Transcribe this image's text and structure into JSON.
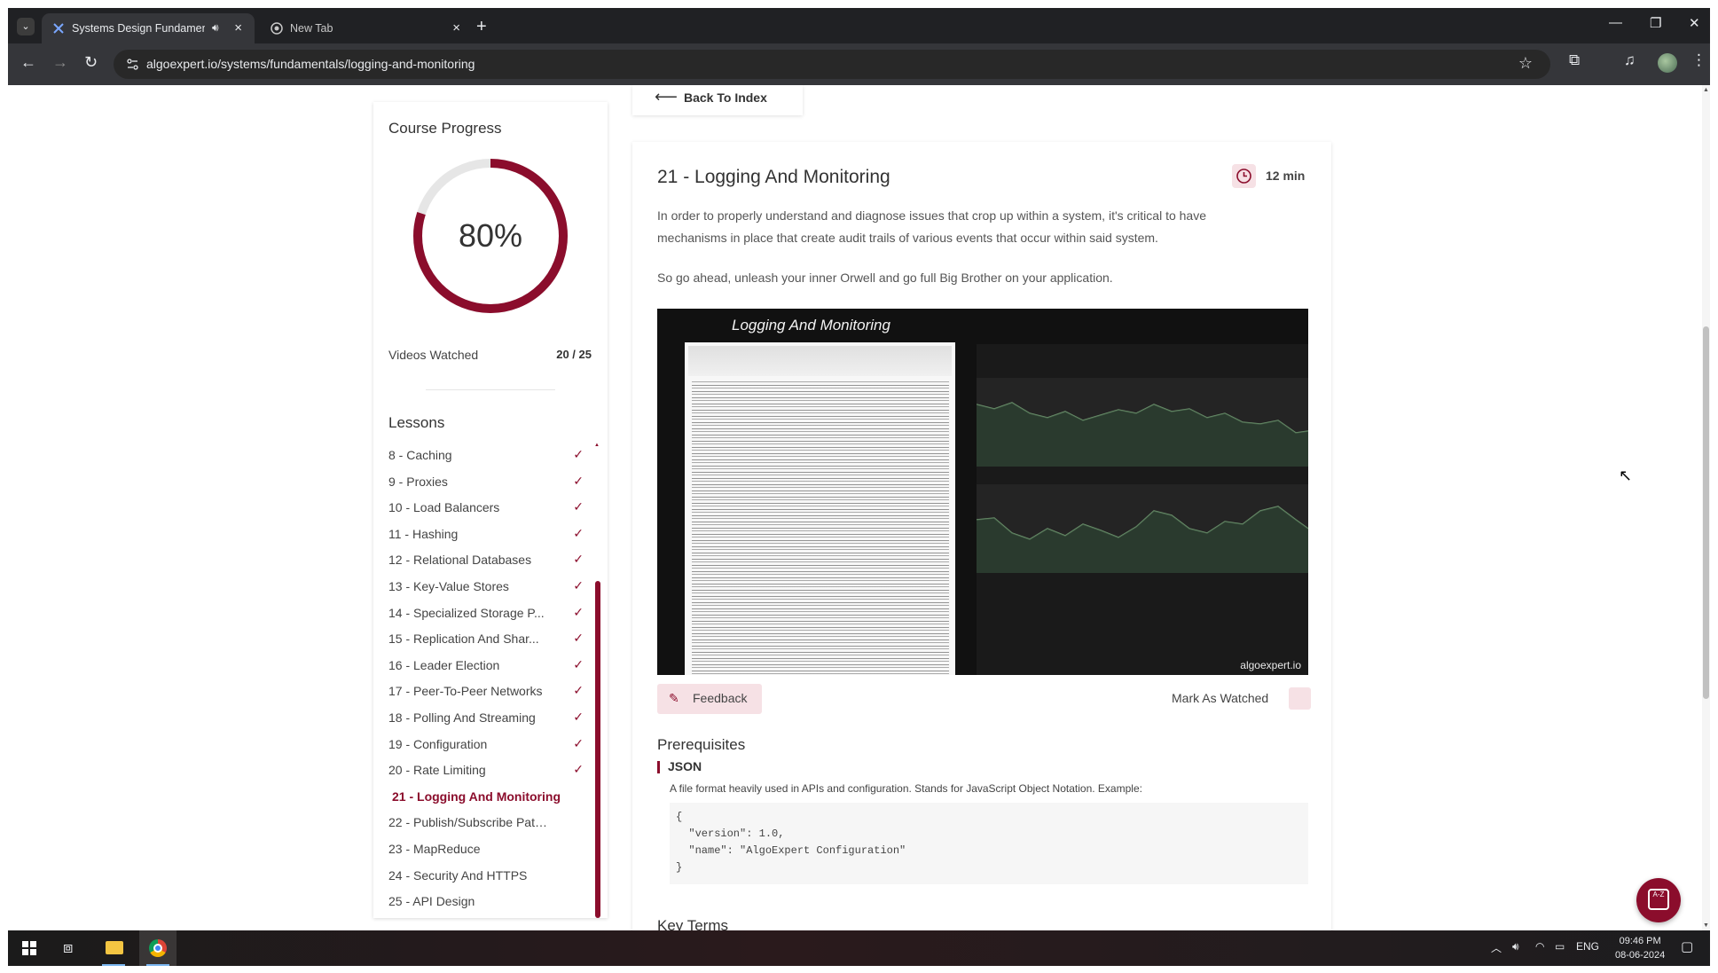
{
  "browser": {
    "tabs": [
      {
        "title": "Systems Design Fundamentals",
        "active": true
      },
      {
        "title": "New Tab",
        "active": false
      }
    ],
    "url_host": "algoexpert.io",
    "url_path": "/systems/fundamentals/logging-and-monitoring",
    "new_tab_symbol": "+"
  },
  "sidebar": {
    "progress_title": "Course Progress",
    "progress_percent": 80,
    "progress_label": "80%",
    "videos_watched_label": "Videos Watched",
    "videos_watched_count": "20 / 25",
    "lessons_title": "Lessons",
    "lessons": [
      {
        "label": "8 - Caching",
        "done": true
      },
      {
        "label": "9 - Proxies",
        "done": true
      },
      {
        "label": "10 - Load Balancers",
        "done": true
      },
      {
        "label": "11 - Hashing",
        "done": true
      },
      {
        "label": "12 - Relational Databases",
        "done": true
      },
      {
        "label": "13 - Key-Value Stores",
        "done": true
      },
      {
        "label": "14 - Specialized Storage P...",
        "done": true
      },
      {
        "label": "15 - Replication And Shar...",
        "done": true
      },
      {
        "label": "16 - Leader Election",
        "done": true
      },
      {
        "label": "17 - Peer-To-Peer Networks",
        "done": true
      },
      {
        "label": "18 - Polling And Streaming",
        "done": true
      },
      {
        "label": "19 - Configuration",
        "done": true
      },
      {
        "label": "20 - Rate Limiting",
        "done": true
      },
      {
        "label": "21 - Logging And Monitoring",
        "done": false,
        "current": true
      },
      {
        "label": "22 - Publish/Subscribe Pattern",
        "done": false
      },
      {
        "label": "23 - MapReduce",
        "done": false
      },
      {
        "label": "24 - Security And HTTPS",
        "done": false
      },
      {
        "label": "25 - API Design",
        "done": false
      }
    ]
  },
  "back_button": "Back To Index",
  "lesson": {
    "title": "21 - Logging And Monitoring",
    "duration": "12 min",
    "description": "In order to properly understand and diagnose issues that crop up within a system, it's critical to have mechanisms in place that create audit trails of various events that occur within said system.",
    "description2": "So go ahead, unleash your inner Orwell and go full Big Brother on your application.",
    "video_title": "Logging And Monitoring",
    "video_watermark": "algoexpert.io",
    "feedback_label": "Feedback",
    "mark_watched_label": "Mark As Watched"
  },
  "prerequisites": {
    "title": "Prerequisites",
    "items": [
      {
        "name": "JSON",
        "description": "A file format heavily used in APIs and configuration. Stands for JavaScript Object Notation. Example:",
        "code": [
          "{",
          "  \"version\": 1.0,",
          "  \"name\": \"AlgoExpert Configuration\"",
          "}"
        ]
      }
    ]
  },
  "key_terms_title": "Key Terms",
  "taskbar": {
    "language": "ENG",
    "time": "09:46 PM",
    "date": "08-06-2024"
  },
  "colors": {
    "accent": "#8b0d2c",
    "accent_light": "#f6e1e5",
    "ring_track": "#e6e6e6"
  }
}
